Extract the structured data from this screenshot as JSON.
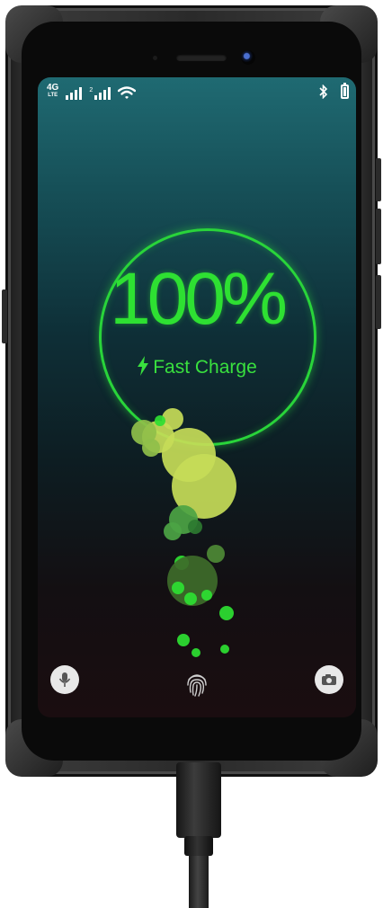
{
  "status_bar": {
    "network_type": "4G",
    "network_sub": "LTE",
    "sim2_label": "2",
    "icons": [
      "signal-icon",
      "signal-icon",
      "wifi-icon",
      "bluetooth-icon",
      "battery-icon"
    ]
  },
  "charging": {
    "percent": "100%",
    "mode": "Fast Charge",
    "level": 1.0
  },
  "shortcuts": {
    "left": "mic-icon",
    "center": "fingerprint-icon",
    "right": "camera-icon"
  },
  "colors": {
    "accent": "#2ee032",
    "ring": "#29d43a",
    "bubble_light": "#c6dc58",
    "bubble_dark": "#3e6b2a"
  }
}
